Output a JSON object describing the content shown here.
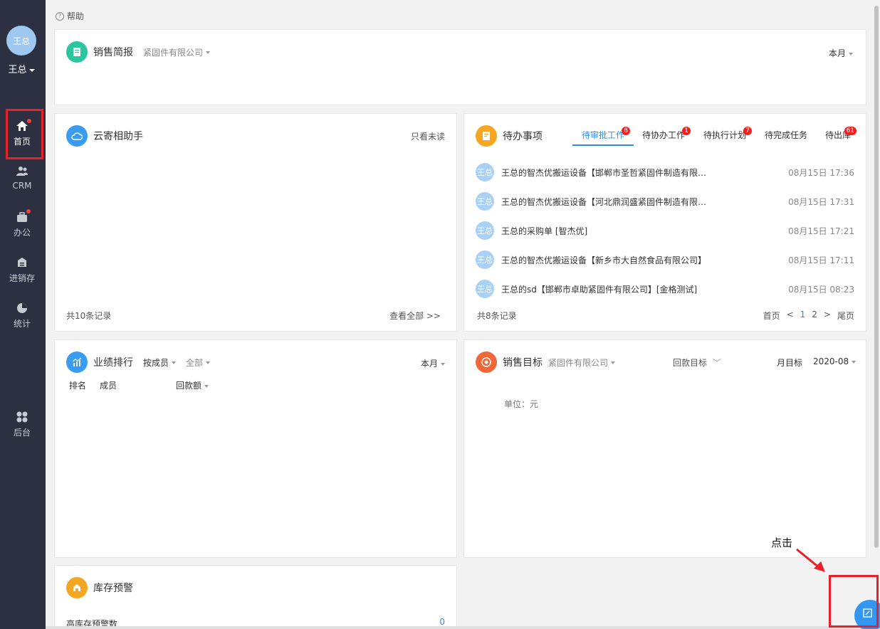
{
  "user": {
    "avatar_text": "王总",
    "name": "王总"
  },
  "nav": [
    {
      "label": "首页",
      "icon": "home-icon"
    },
    {
      "label": "CRM",
      "icon": "users-icon"
    },
    {
      "label": "办公",
      "icon": "briefcase-icon"
    },
    {
      "label": "进销存",
      "icon": "inventory-icon"
    },
    {
      "label": "统计",
      "icon": "pie-chart-icon"
    },
    {
      "label": "后台",
      "icon": "grid-icon"
    }
  ],
  "help": {
    "label": "帮助"
  },
  "sales_report": {
    "title": "销售简报",
    "company": "紧固件有限公司",
    "period": "本月"
  },
  "assistant": {
    "title": "云寄相助手",
    "filter": "只看未读",
    "count": "共10条记录",
    "view_all": "查看全部 >>"
  },
  "todo": {
    "title": "待办事项",
    "tabs": [
      {
        "label": "待审批工作",
        "badge": "8"
      },
      {
        "label": "待协办工作",
        "badge": "1"
      },
      {
        "label": "待执行计划",
        "badge": "7"
      },
      {
        "label": "待完成任务",
        "badge": ""
      },
      {
        "label": "待出库",
        "badge": "61"
      }
    ],
    "items": [
      {
        "avatar": "王总",
        "text": "王总的智杰优搬运设备【邯郸市圣哲紧固件制造有限公司】",
        "time": "08月15日 17:36"
      },
      {
        "avatar": "王总",
        "text": "王总的智杰优搬运设备【河北鼎润盛紧固件制造有限公司】",
        "time": "08月15日 17:31"
      },
      {
        "avatar": "王总",
        "text": "王总的采购单 [智杰优]",
        "time": "08月15日 17:21"
      },
      {
        "avatar": "王总",
        "text": "王总的智杰优搬运设备【新乡市大自然食品有限公司】",
        "time": "08月15日 17:11"
      },
      {
        "avatar": "王总",
        "text": "王总的sd【邯郸市卓助紧固件有限公司】[金格测试]",
        "time": "08月15日 08:23"
      }
    ],
    "count": "共8条记录",
    "pager": {
      "first": "首页",
      "prev": "<",
      "p1": "1",
      "p2": "2",
      "next": ">",
      "last": "尾页"
    }
  },
  "ranking": {
    "title": "业绩排行",
    "by": "按成员",
    "scope": "全部",
    "period": "本月",
    "col_rank": "排名",
    "col_member": "成员",
    "col_metric": "回款额"
  },
  "target": {
    "title": "销售目标",
    "company": "紧固件有限公司",
    "type": "回款目标",
    "period_type": "月目标",
    "month": "2020-08",
    "unit": "单位：元"
  },
  "stock": {
    "title": "库存预警",
    "high_label": "高库存预警数",
    "high_value": "0"
  },
  "annotation": {
    "click_label": "点击"
  },
  "colors": {
    "sidebar": "#2d3040",
    "accent": "#2d8cf0",
    "highlight": "#e8202a",
    "badge": "#f02020"
  }
}
